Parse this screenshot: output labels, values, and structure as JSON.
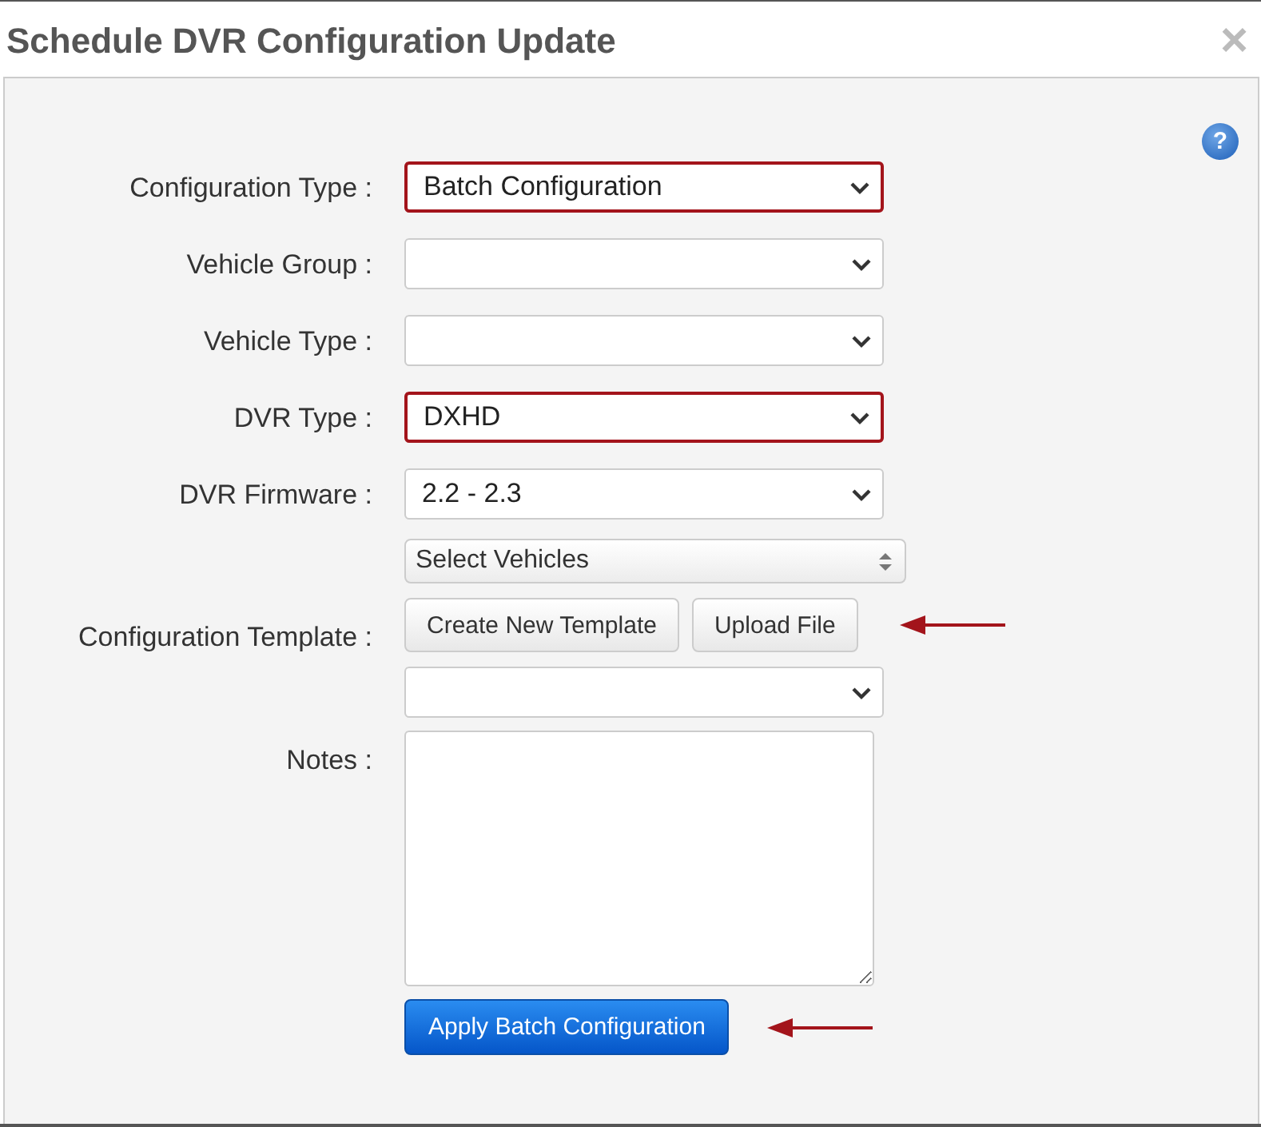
{
  "dialog": {
    "title": "Schedule DVR Configuration Update",
    "close": "×",
    "help": "?"
  },
  "fields": [
    {
      "kind": "select",
      "label": "Configuration Type :",
      "value": "Batch Configuration",
      "highlighted": true
    },
    {
      "kind": "select",
      "label": "Vehicle Group :",
      "highlighted": false
    },
    {
      "kind": "select",
      "label": "Vehicle Type :",
      "highlighted": false
    },
    {
      "kind": "select",
      "label": "DVR Type :",
      "value": "DXHD",
      "highlighted": true
    },
    {
      "kind": "select",
      "label": "DVR Firmware :",
      "value": "2.2 - 2.3",
      "highlighted": false
    },
    {
      "kind": "template",
      "label": "Configuration Template :",
      "picker": "Select Vehicles",
      "buttons": [
        "Create New Template",
        "Upload File"
      ],
      "arrow": true
    },
    {
      "kind": "textarea",
      "label": "Notes :"
    }
  ],
  "submit": {
    "label": "Apply Batch Configuration",
    "arrow": true
  }
}
